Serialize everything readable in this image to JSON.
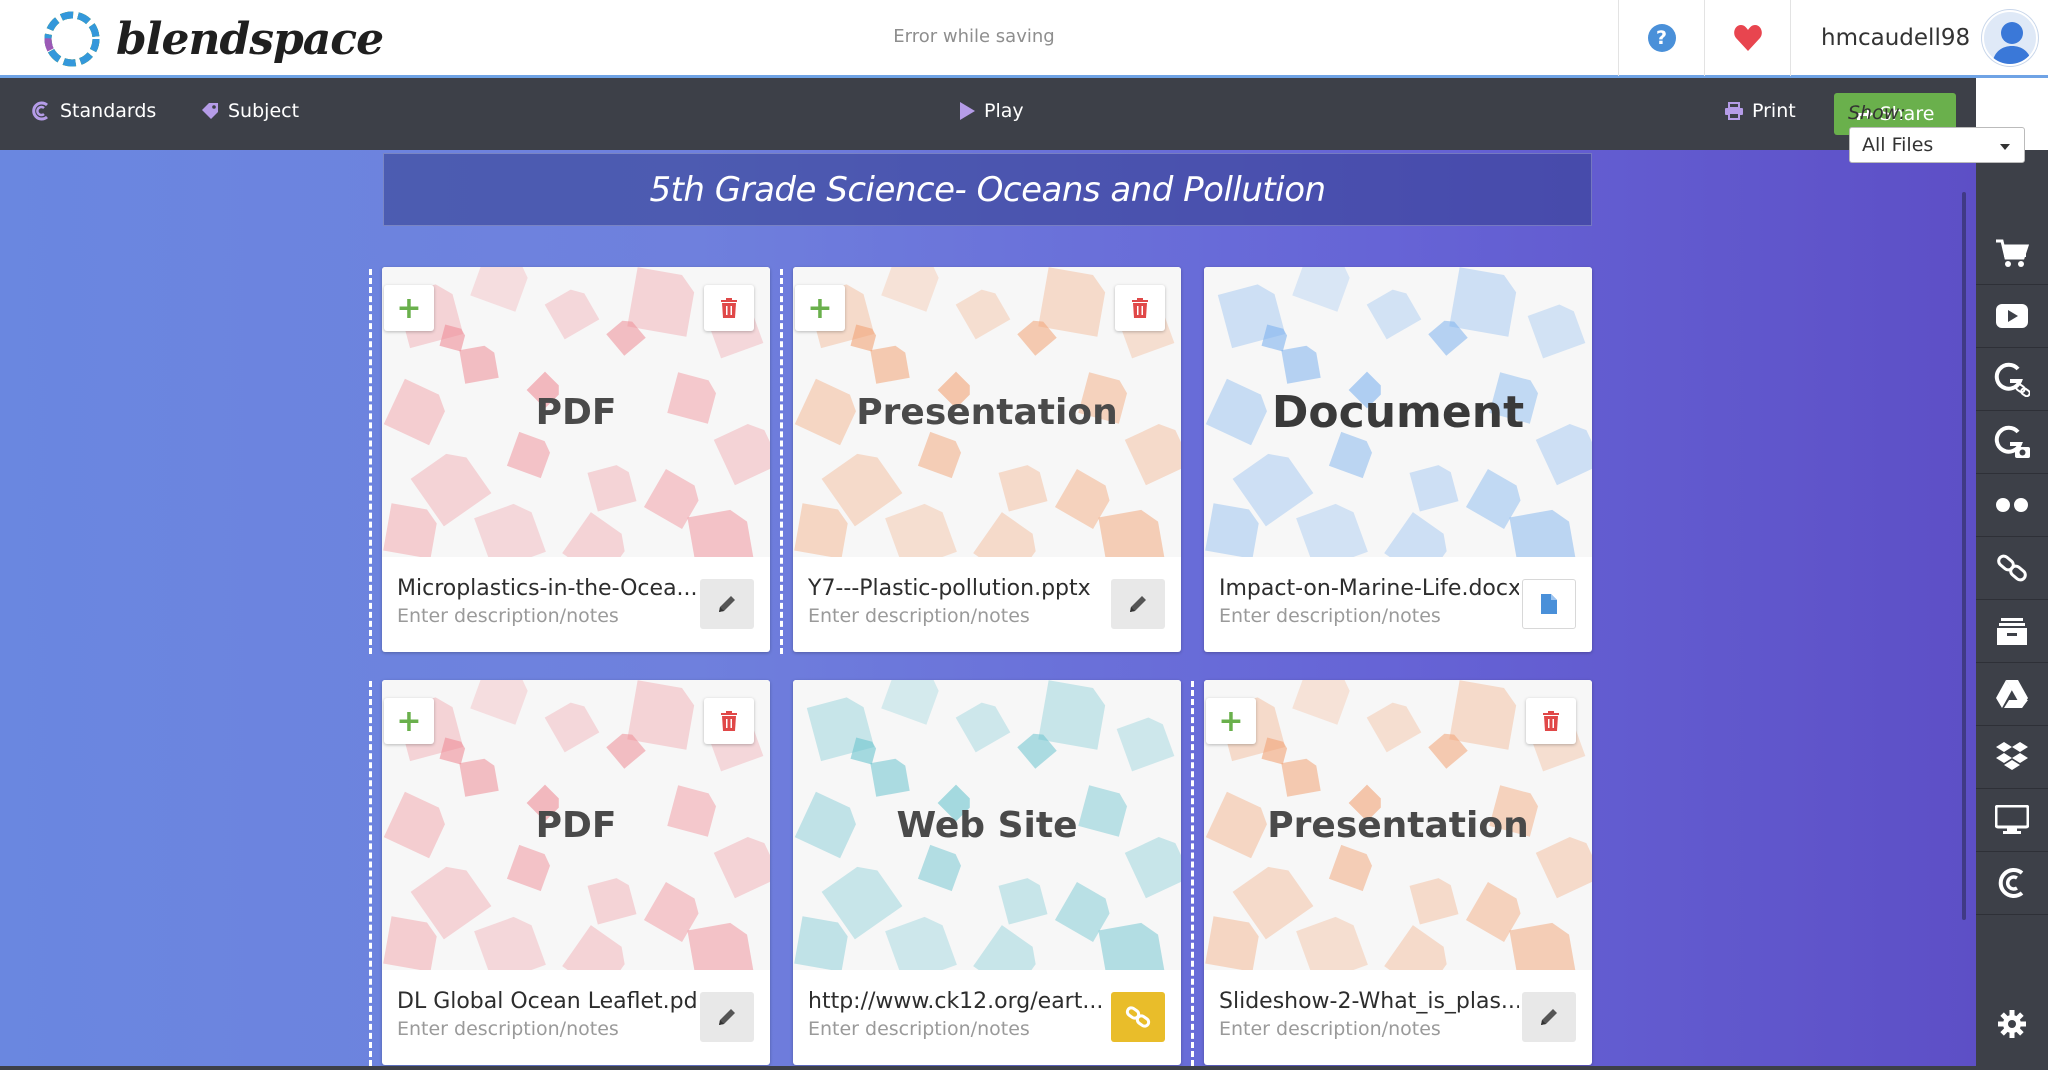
{
  "app": {
    "logo_text": "blendspace",
    "save_status": "Error while saving",
    "username": "hmcaudell98"
  },
  "toolbar": {
    "standards": "Standards",
    "subject": "Subject",
    "play": "Play",
    "print": "Print",
    "share": "Share"
  },
  "filter": {
    "label": "Show:",
    "selected": "All Files"
  },
  "lesson": {
    "title": "5th Grade Science- Oceans and Pollution"
  },
  "cards": [
    {
      "type": "PDF",
      "filename": "Microplastics-in-the-Ocea...",
      "description_placeholder": "Enter description/notes",
      "color": "#ef8e97",
      "action": "edit"
    },
    {
      "type": "Presentation",
      "filename": "Y7---Plastic-pollution.pptx",
      "description_placeholder": "Enter description/notes",
      "color": "#f2a476",
      "action": "edit"
    },
    {
      "type": "Document",
      "filename": "Impact-on-Marine-Life.docx",
      "description_placeholder": "Enter description/notes",
      "color": "#7fb3ee",
      "action": "file"
    },
    {
      "type": "PDF",
      "filename": "DL Global Ocean Leaflet.pdf",
      "description_placeholder": "Enter description/notes",
      "color": "#ef8e97",
      "action": "edit"
    },
    {
      "type": "Web Site",
      "filename": "http://www.ck12.org/eart...",
      "description_placeholder": "Enter description/notes",
      "color": "#6dc4cf",
      "action": "link"
    },
    {
      "type": "Presentation",
      "filename": "Slideshow-2-What_is_plas...",
      "description_placeholder": "Enter description/notes",
      "color": "#f2a476",
      "action": "edit"
    }
  ],
  "rail": [
    "cart-icon",
    "youtube-icon",
    "google-link-icon",
    "google-image-icon",
    "flickr-icon",
    "link-icon",
    "archive-icon",
    "google-drive-icon",
    "dropbox-icon",
    "computer-icon",
    "blendspace-icon",
    "gear-icon"
  ],
  "colors": {
    "toolbar": "#3d4048",
    "share": "#6ab04c",
    "accent": "#4a90d9",
    "link_button": "#e9bd2a"
  }
}
